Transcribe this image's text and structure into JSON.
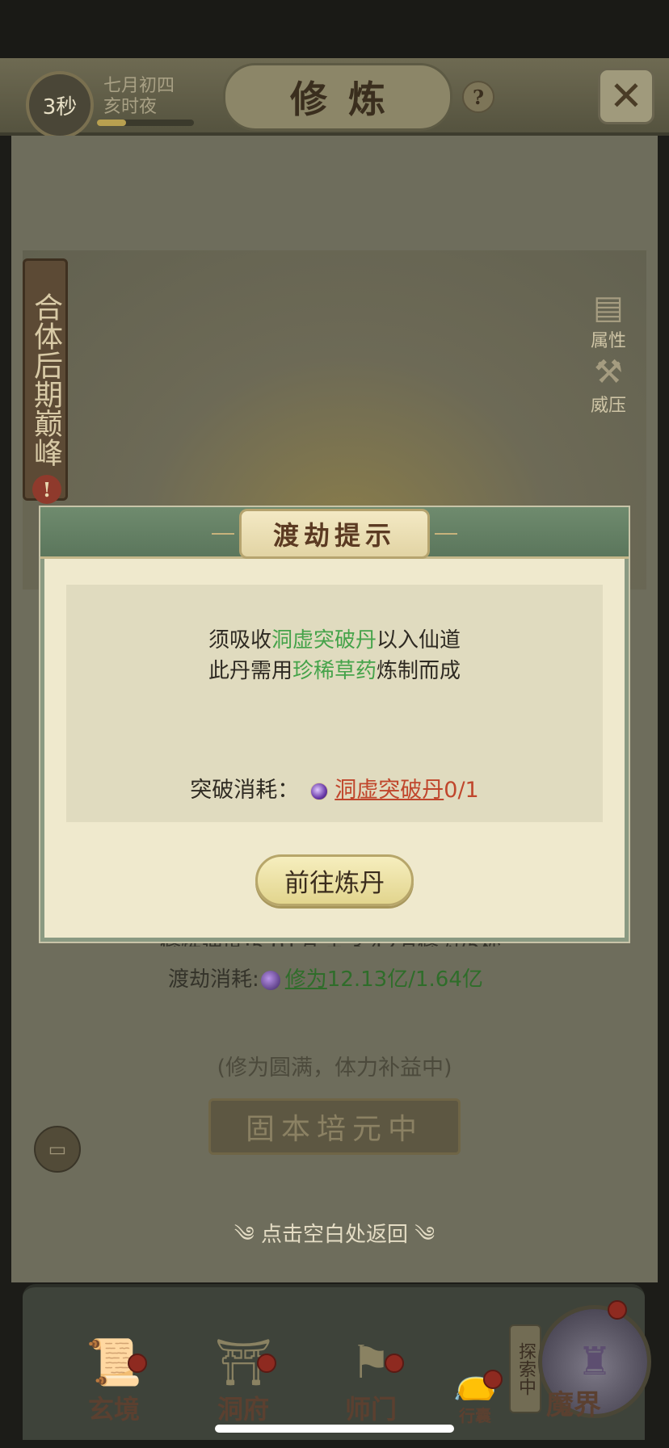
{
  "header": {
    "timer": "3秒",
    "date_line1": "七月初四",
    "date_line2": "亥时夜",
    "timer_progress": 0.3,
    "title": "修炼",
    "help_icon": "?",
    "close_icon": "close-icon"
  },
  "realm": {
    "name": "合体后期巅峰",
    "alert": "!"
  },
  "side_buttons": [
    {
      "label": "属性",
      "icon": "scroll-icon"
    },
    {
      "label": "威压",
      "icon": "axe-icon"
    }
  ],
  "background_info": {
    "speed_line": "修炼速度:5.01万 + 3.42万修为/5秒",
    "cost_label": "渡劫消耗:",
    "cost_item": "修为",
    "cost_value": "12.13亿/1.64亿",
    "status_hint": "(修为圆满，体力补益中)",
    "status_button": "固本培元中"
  },
  "return_hint": "点击空白处返回",
  "modal": {
    "title": "渡劫提示",
    "line1_prefix": "须吸收",
    "line1_highlight": "洞虚突破丹",
    "line1_suffix": "以入仙道",
    "line2_prefix": "此丹需用",
    "line2_highlight": "珍稀草药",
    "line2_suffix": "炼制而成",
    "cost_label": "突破消耗：",
    "cost_item": "洞虚突破丹",
    "cost_count": "0/1",
    "go_button": "前往炼丹"
  },
  "nav": {
    "items": [
      {
        "label": "玄境",
        "icon": "scroll-icon",
        "badge": true
      },
      {
        "label": "洞府",
        "icon": "pavilion-icon",
        "badge": true
      },
      {
        "label": "师门",
        "icon": "banner-icon",
        "badge": true
      },
      {
        "label": "行囊",
        "icon": "bag-icon",
        "badge": true
      }
    ],
    "explore_tag": "探索中",
    "demon_label": "魔界"
  },
  "colors": {
    "accent_green": "#45a34a",
    "cost_red": "#c0462c",
    "modal_bg": "#efe9cd",
    "modal_header": "#6f8b6e"
  }
}
